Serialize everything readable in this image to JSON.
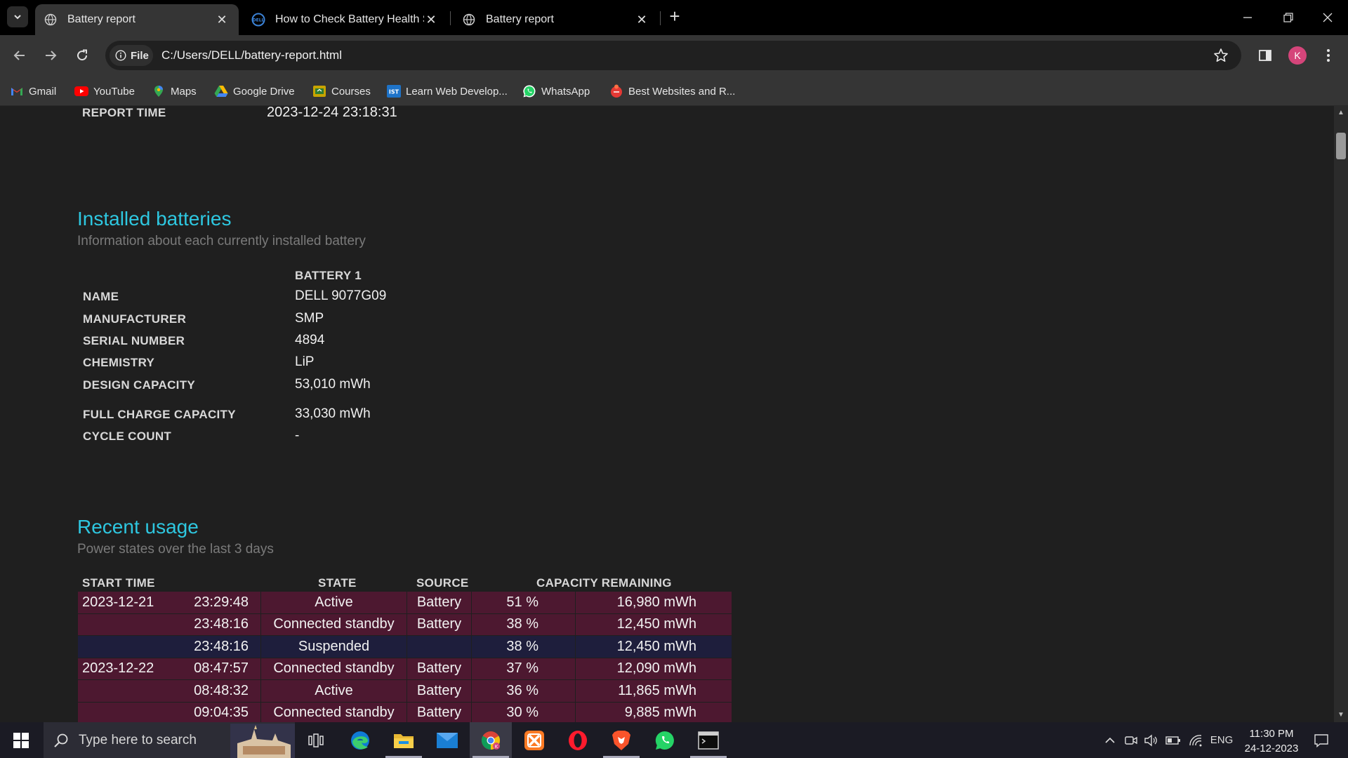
{
  "tabs": [
    {
      "title": "Battery report",
      "active": true
    },
    {
      "title": "How to Check Battery Health St",
      "active": false
    },
    {
      "title": "Battery report",
      "active": false
    }
  ],
  "toolbar": {
    "chip_label": "File",
    "url": "C:/Users/DELL/battery-report.html",
    "avatar_letter": "K"
  },
  "bookmarks": [
    {
      "label": "Gmail",
      "icon": "gmail-icon"
    },
    {
      "label": "YouTube",
      "icon": "youtube-icon"
    },
    {
      "label": "Maps",
      "icon": "maps-icon"
    },
    {
      "label": "Google Drive",
      "icon": "drive-icon"
    },
    {
      "label": "Courses",
      "icon": "courses-icon"
    },
    {
      "label": "Learn Web Develop...",
      "icon": "ist-icon"
    },
    {
      "label": "WhatsApp",
      "icon": "whatsapp-icon"
    },
    {
      "label": "Best Websites and R...",
      "icon": "bookmark-icon"
    }
  ],
  "report": {
    "report_time_label": "REPORT TIME",
    "report_time_value": "2023-12-24  23:18:31"
  },
  "installed": {
    "heading": "Installed batteries",
    "subheading": "Information about each currently installed battery",
    "column": "BATTERY 1",
    "rows": [
      {
        "label": "NAME",
        "value": "DELL 9077G09"
      },
      {
        "label": "MANUFACTURER",
        "value": "SMP"
      },
      {
        "label": "SERIAL NUMBER",
        "value": "4894"
      },
      {
        "label": "CHEMISTRY",
        "value": "LiP"
      },
      {
        "label": "DESIGN CAPACITY",
        "value": "53,010 mWh"
      },
      {
        "label": "FULL CHARGE CAPACITY",
        "value": "33,030 mWh"
      },
      {
        "label": "CYCLE COUNT",
        "value": "-"
      }
    ]
  },
  "recent": {
    "heading": "Recent usage",
    "subheading": "Power states over the last 3 days",
    "headers": {
      "start": "START TIME",
      "state": "STATE",
      "source": "SOURCE",
      "capacity": "CAPACITY REMAINING"
    },
    "rows": [
      {
        "date": "2023-12-21",
        "time": "23:29:48",
        "state": "Active",
        "source": "Battery",
        "pct": "51 %",
        "mwh": "16,980 mWh",
        "tone": "red"
      },
      {
        "date": "",
        "time": "23:48:16",
        "state": "Connected standby",
        "source": "Battery",
        "pct": "38 %",
        "mwh": "12,450 mWh",
        "tone": "red"
      },
      {
        "date": "",
        "time": "23:48:16",
        "state": "Suspended",
        "source": "",
        "pct": "38 %",
        "mwh": "12,450 mWh",
        "tone": "navy"
      },
      {
        "date": "2023-12-22",
        "time": "08:47:57",
        "state": "Connected standby",
        "source": "Battery",
        "pct": "37 %",
        "mwh": "12,090 mWh",
        "tone": "red"
      },
      {
        "date": "",
        "time": "08:48:32",
        "state": "Active",
        "source": "Battery",
        "pct": "36 %",
        "mwh": "11,865 mWh",
        "tone": "red"
      },
      {
        "date": "",
        "time": "09:04:35",
        "state": "Connected standby",
        "source": "Battery",
        "pct": "30 %",
        "mwh": "9,885 mWh",
        "tone": "red"
      }
    ]
  },
  "taskbar": {
    "search_placeholder": "Type here to search",
    "language": "ENG",
    "time": "11:30 PM",
    "date": "24-12-2023"
  },
  "colors": {
    "heading": "#2ec7e0",
    "row_red": "#4d1830",
    "row_navy": "#1e1e3c",
    "page_bg": "#1f1f1f"
  }
}
